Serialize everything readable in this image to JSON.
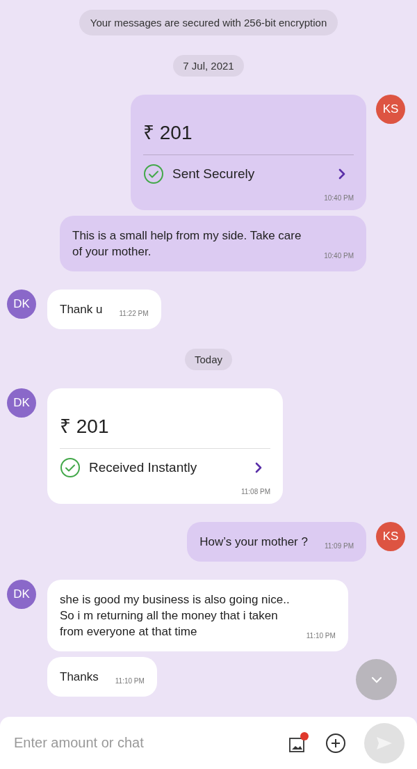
{
  "chat": [
    {
      "kind": "notice",
      "text": "Your messages are secured with 256-bit encryption"
    },
    {
      "kind": "date",
      "text": "7 Jul, 2021"
    },
    {
      "kind": "payment",
      "outgoing": true,
      "avatar": "KS",
      "amount": "₹ 201",
      "status": "Sent Securely",
      "time": "10:40 PM"
    },
    {
      "kind": "text",
      "outgoing": true,
      "text": "This is a small help from my side. Take care of your mother.",
      "time": "10:40 PM"
    },
    {
      "kind": "text",
      "outgoing": false,
      "avatar": "DK",
      "text": "Thank u",
      "time": "11:22 PM"
    },
    {
      "kind": "date",
      "text": "Today"
    },
    {
      "kind": "payment",
      "outgoing": false,
      "avatar": "DK",
      "amount": "₹ 201",
      "status": "Received Instantly",
      "time": "11:08 PM"
    },
    {
      "kind": "text",
      "outgoing": true,
      "avatar": "KS",
      "text": "How’s your mother ?",
      "time": "11:09 PM"
    },
    {
      "kind": "text",
      "outgoing": false,
      "avatar": "DK",
      "text": "she is good my business is also going nice..\nSo i m returning all the money that i taken\nfrom everyone at that time",
      "time": "11:10 PM"
    },
    {
      "kind": "text",
      "outgoing": false,
      "text": "Thanks",
      "time": "11:10 PM"
    }
  ],
  "composer": {
    "placeholder": "Enter amount or chat",
    "attachment_badge": true
  }
}
